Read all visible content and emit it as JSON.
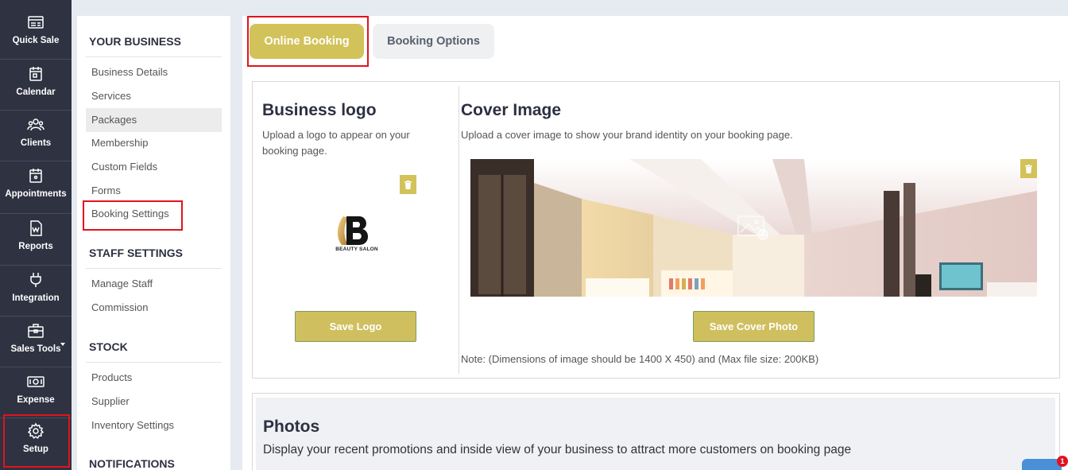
{
  "rail": {
    "items": [
      {
        "label": "Quick Sale",
        "icon": "quick-sale-icon"
      },
      {
        "label": "Calendar",
        "icon": "calendar-icon"
      },
      {
        "label": "Clients",
        "icon": "clients-icon"
      },
      {
        "label": "Appointments",
        "icon": "appointments-icon"
      },
      {
        "label": "Reports",
        "icon": "reports-icon"
      },
      {
        "label": "Integration",
        "icon": "plug-icon"
      },
      {
        "label": "Sales Tools",
        "icon": "briefcase-icon"
      },
      {
        "label": "Expense",
        "icon": "money-icon"
      },
      {
        "label": "Setup",
        "icon": "gear-icon"
      }
    ]
  },
  "settings": {
    "sections": [
      {
        "title": "YOUR BUSINESS",
        "items": [
          "Business Details",
          "Services",
          "Packages",
          "Membership",
          "Custom Fields",
          "Forms",
          "Booking Settings"
        ]
      },
      {
        "title": "STAFF SETTINGS",
        "items": [
          "Manage Staff",
          "Commission"
        ]
      },
      {
        "title": "STOCK",
        "items": [
          "Products",
          "Supplier",
          "Inventory Settings"
        ]
      },
      {
        "title": "NOTIFICATIONS",
        "items": []
      }
    ],
    "active_item": "Packages"
  },
  "tabs": {
    "online_booking": "Online Booking",
    "booking_options": "Booking Options"
  },
  "logo_section": {
    "title": "Business logo",
    "description": "Upload a logo to appear on your booking page.",
    "logo_text": "BEAUTY SALON",
    "save_label": "Save Logo"
  },
  "cover_section": {
    "title": "Cover Image",
    "description": "Upload a cover image to show your brand identity on your booking page.",
    "save_label": "Save Cover Photo",
    "note": "Note: (Dimensions of image should be 1400 X 450) and (Max file size: 200KB)"
  },
  "photos_section": {
    "title": "Photos",
    "description": "Display your recent promotions and inside view of your business to attract more customers on booking page"
  },
  "chat": {
    "badge_count": "1"
  },
  "colors": {
    "accent": "#d2c25a",
    "rail": "#2f3241",
    "highlight": "#e0141e"
  }
}
